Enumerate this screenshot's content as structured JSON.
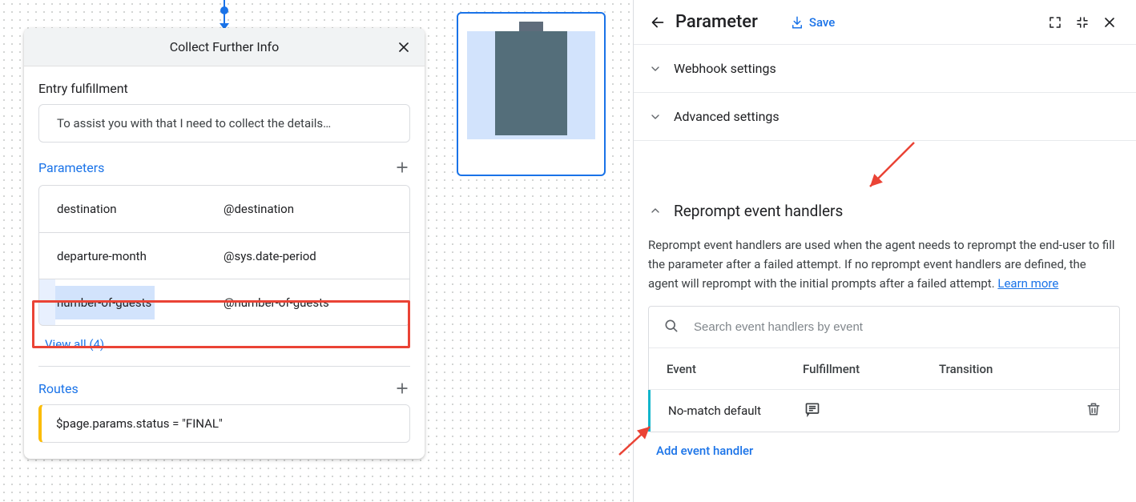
{
  "canvas": {
    "page_title": "Collect Further Info",
    "entry_fulfillment_label": "Entry fulfillment",
    "entry_fulfillment_text": "To assist you with that I need to collect the details…",
    "parameters_label": "Parameters",
    "params": [
      {
        "name": "destination",
        "entity": "@destination"
      },
      {
        "name": "departure-month",
        "entity": "@sys.date-period"
      },
      {
        "name": "number-of-guests",
        "entity": "@number-of-guests"
      }
    ],
    "view_all_label": "View all (4)",
    "routes_label": "Routes",
    "route_condition": "$page.params.status = \"FINAL\""
  },
  "drawer": {
    "title": "Parameter",
    "save_label": "Save",
    "webhook_label": "Webhook settings",
    "advanced_label": "Advanced settings",
    "reprompt_title": "Reprompt event handlers",
    "reprompt_desc_1": "Reprompt event handlers are used when the agent needs to reprompt the end-user to fill the parameter after a failed attempt. If no reprompt event handlers are defined, the agent will reprompt with the initial prompts after a failed attempt. ",
    "reprompt_learn_more": "Learn more",
    "search_placeholder": "Search event handlers by event",
    "th_event": "Event",
    "th_fulfillment": "Fulfillment",
    "th_transition": "Transition",
    "row_event": "No-match default",
    "add_handler_label": "Add event handler"
  }
}
